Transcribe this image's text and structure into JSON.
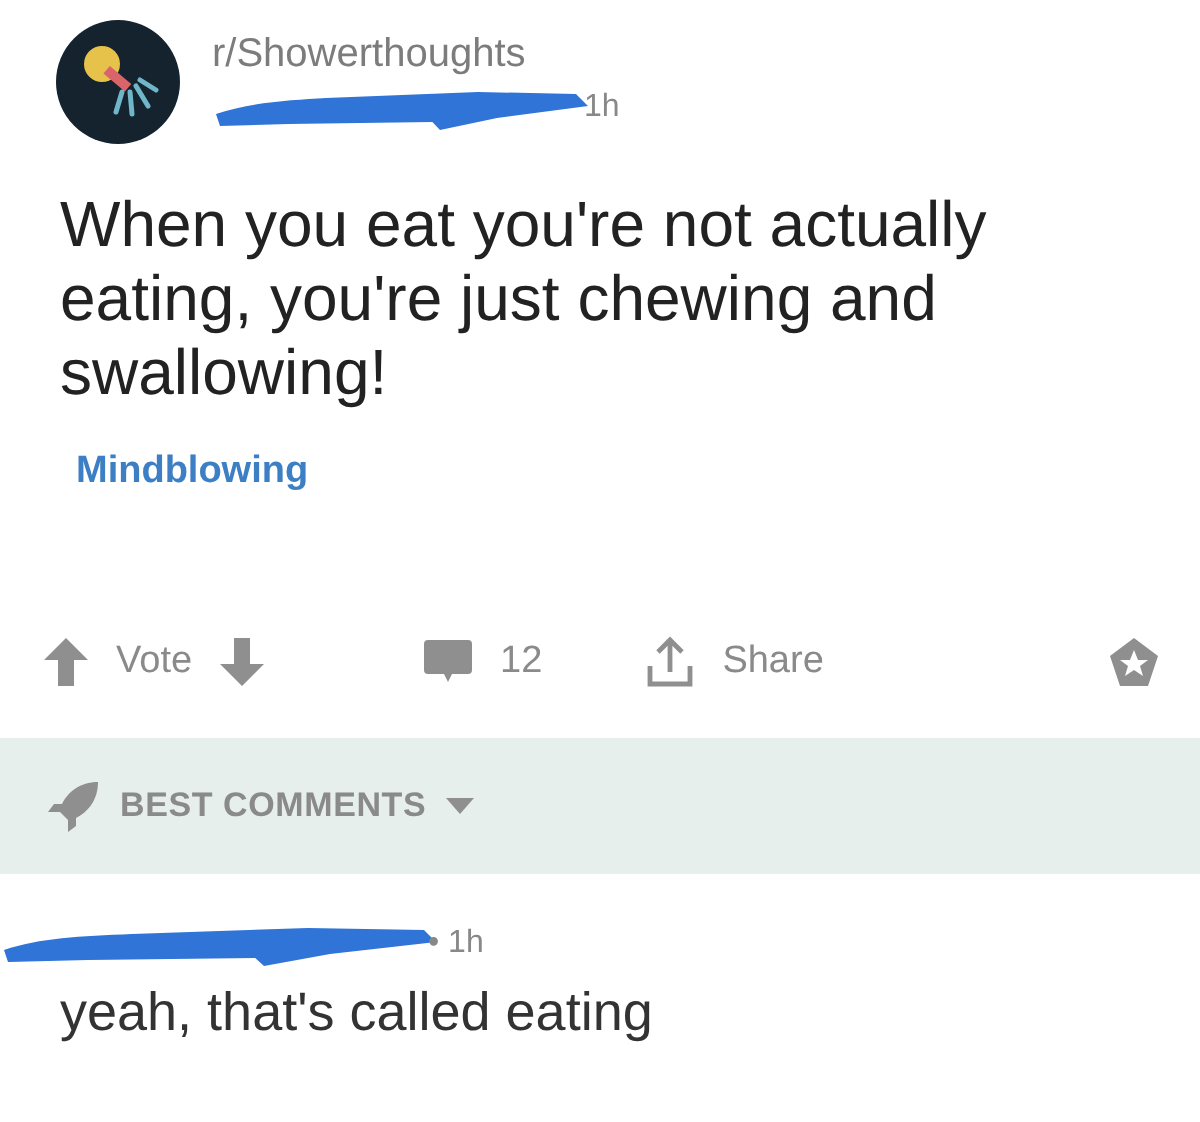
{
  "post": {
    "subreddit": "r/Showerthoughts",
    "time": "1h",
    "title": "When you eat you're not actually eating, you're just chewing and swallowing!",
    "flair": "Mindblowing"
  },
  "actions": {
    "vote": "Vote",
    "comments": "12",
    "share": "Share"
  },
  "sort": {
    "label": "BEST COMMENTS"
  },
  "comment": {
    "time": "• 1h",
    "text": "yeah, that's called eating"
  }
}
